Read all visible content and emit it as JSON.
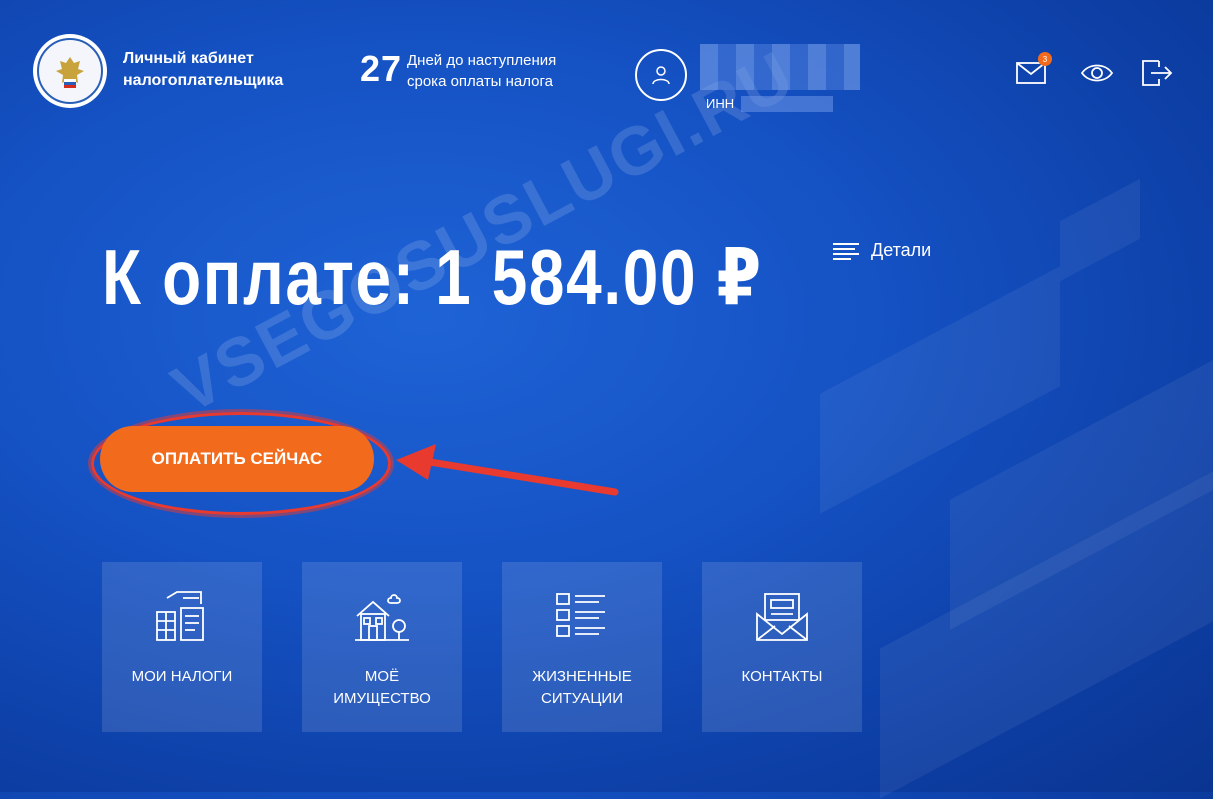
{
  "header": {
    "brand_line1": "Личный кабинет",
    "brand_line2": "налогоплательщика",
    "days_count": "27",
    "days_line1": "Дней до наступления",
    "days_line2": "срока оплаты налога",
    "inn_label": "ИНН",
    "mail_badge": "3",
    "icons": [
      "mail-icon",
      "eye-icon",
      "logout-icon"
    ]
  },
  "main": {
    "amount": "К оплате: 1 584.00 ₽",
    "details_label": "Детали",
    "pay_button": "ОПЛАТИТЬ СЕЙЧАС"
  },
  "watermark": "VSEGOSUSLUGI.RU",
  "tiles": [
    {
      "line1": "МОИ НАЛОГИ",
      "line2": "",
      "icon": "taxes-icon"
    },
    {
      "line1": "МОЁ",
      "line2": "ИМУЩЕСТВО",
      "icon": "property-icon"
    },
    {
      "line1": "ЖИЗНЕННЫЕ",
      "line2": "СИТУАЦИИ",
      "icon": "list-icon"
    },
    {
      "line1": "КОНТАКТЫ",
      "line2": "",
      "icon": "envelope-icon"
    }
  ],
  "colors": {
    "background": "#1552c4",
    "accent": "#f26b1d",
    "highlight": "#e83a2e"
  }
}
